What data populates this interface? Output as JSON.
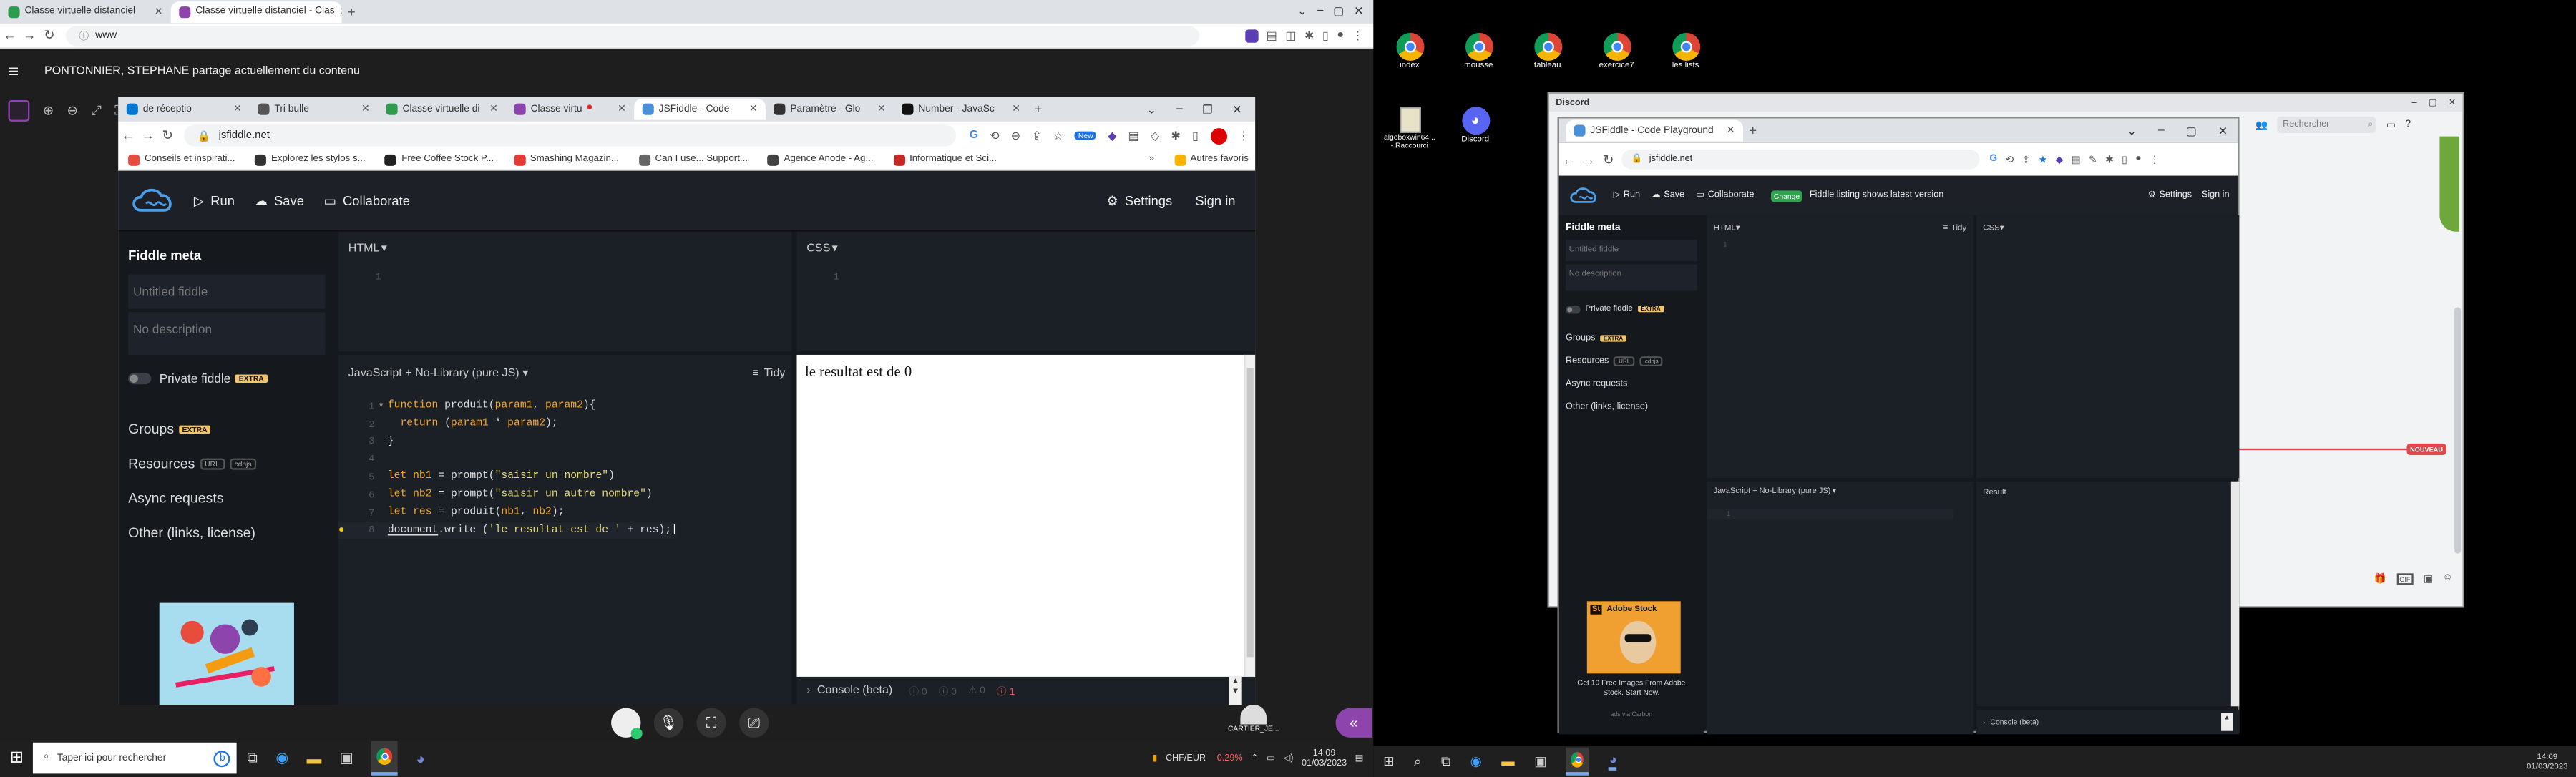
{
  "chrome_main": {
    "tabs": [
      {
        "label": "Classe virtuelle distanciel",
        "color": "#2e9c4d"
      },
      {
        "label": "Classe virtuelle distanciel - Clas",
        "color": "#8e44ad"
      }
    ],
    "url": "www"
  },
  "share_banner": {
    "text": "PONTONNIER, STEPHANE partage actuellement du contenu"
  },
  "inner_browser": {
    "tabs": [
      {
        "label": "de réceptio"
      },
      {
        "label": "Tri bulle"
      },
      {
        "label": "Classe virtuelle di"
      },
      {
        "label": "Classe virtu"
      },
      {
        "label": "JSFiddle - Code"
      },
      {
        "label": "Paramètre - Glo"
      },
      {
        "label": "Number - JavaSc"
      }
    ],
    "url": "jsfiddle.net",
    "bookmarks": [
      {
        "label": "Conseils et inspirati..."
      },
      {
        "label": "Explorez les stylos s..."
      },
      {
        "label": "Free Coffee Stock P..."
      },
      {
        "label": "Smashing Magazin..."
      },
      {
        "label": "Can I use... Support..."
      },
      {
        "label": "Agence Anode - Ag..."
      },
      {
        "label": "Informatique et Sci..."
      }
    ],
    "more_bookmarks": "»",
    "other_favorites": "Autres favoris"
  },
  "jsfiddle": {
    "run": "Run",
    "save": "Save",
    "collaborate": "Collaborate",
    "settings": "Settings",
    "signin": "Sign in",
    "sidebar": {
      "meta_title": "Fiddle meta",
      "title_placeholder": "Untitled fiddle",
      "desc_placeholder": "No description",
      "private": "Private fiddle",
      "extra": "EXTRA",
      "groups": "Groups",
      "resources": "Resources",
      "url_tag": "URL",
      "cdnjs_tag": "cdnjs",
      "async": "Async requests",
      "other": "Other (links, license)"
    },
    "html_label": "HTML",
    "css_label": "CSS",
    "js_label": "JavaScript + No-Library (pure JS)",
    "tidy": "Tidy",
    "html_lines": [
      "1"
    ],
    "css_lines": [
      "1"
    ],
    "code_lines": [
      {
        "n": "1",
        "text": "function produit(param1, param2){"
      },
      {
        "n": "2",
        "text": "  return (param1 * param2);"
      },
      {
        "n": "3",
        "text": "}"
      },
      {
        "n": "4",
        "text": ""
      },
      {
        "n": "5",
        "text": "let nb1 = prompt(\"saisir un nombre\")"
      },
      {
        "n": "6",
        "text": "let nb2 = prompt(\"saisir un autre nombre\")"
      },
      {
        "n": "7",
        "text": "let res = produit(nb1, nb2);"
      },
      {
        "n": "8",
        "text": "document.write ('le resultat est de ' + res);"
      }
    ],
    "result_text": "le resultat est de 0",
    "console_label": "Console (beta)",
    "console_counts": [
      "0",
      "0",
      "0",
      "1"
    ]
  },
  "meeting": {
    "participant": "CARTIER_JE..."
  },
  "taskbar_left": {
    "search_placeholder": "Taper ici pour rechercher",
    "currency": "CHF/EUR",
    "currency_change": "-0.29%",
    "time": "14:09",
    "date": "01/03/2023"
  },
  "desktop": {
    "icons": [
      {
        "label": "index"
      },
      {
        "label": "mousse"
      },
      {
        "label": "tableau"
      },
      {
        "label": "exercice7"
      },
      {
        "label": "les lists"
      }
    ],
    "icons2": [
      {
        "label": "algoboxwin64... - Raccourci"
      },
      {
        "label": "Discord"
      }
    ]
  },
  "discord": {
    "title": "Discord",
    "search_placeholder": "Rechercher",
    "new_badge": "NOUVEAU"
  },
  "right_browser": {
    "tab_label": "JSFiddle - Code Playground",
    "url": "jsfiddle.net",
    "run": "Run",
    "save": "Save",
    "collaborate": "Collaborate",
    "change_badge": "Change",
    "listing_notice": "Fiddle listing shows latest version",
    "settings": "Settings",
    "signin": "Sign in",
    "sidebar": {
      "meta_title": "Fiddle meta",
      "title_placeholder": "Untitled fiddle",
      "desc_placeholder": "No description",
      "private": "Private fiddle",
      "extra": "EXTRA",
      "groups": "Groups",
      "resources": "Resources",
      "url_tag": "URL",
      "cdnjs_tag": "cdnjs",
      "async": "Async requests",
      "other": "Other (links, license)"
    },
    "html_label": "HTML",
    "css_label": "CSS",
    "tidy": "Tidy",
    "js_label": "JavaScript + No-Library (pure JS)",
    "result_label": "Result",
    "console_label": "Console (beta)",
    "ad_brand": "Adobe Stock",
    "ad_text": "Get 10 Free Images From Adobe Stock. Start Now.",
    "ad_via": "ads via Carbon",
    "html_lines": [
      "1"
    ],
    "js_lines": [
      "1"
    ]
  },
  "taskbar_right": {
    "time": "14:09",
    "date": "01/03/2023"
  }
}
